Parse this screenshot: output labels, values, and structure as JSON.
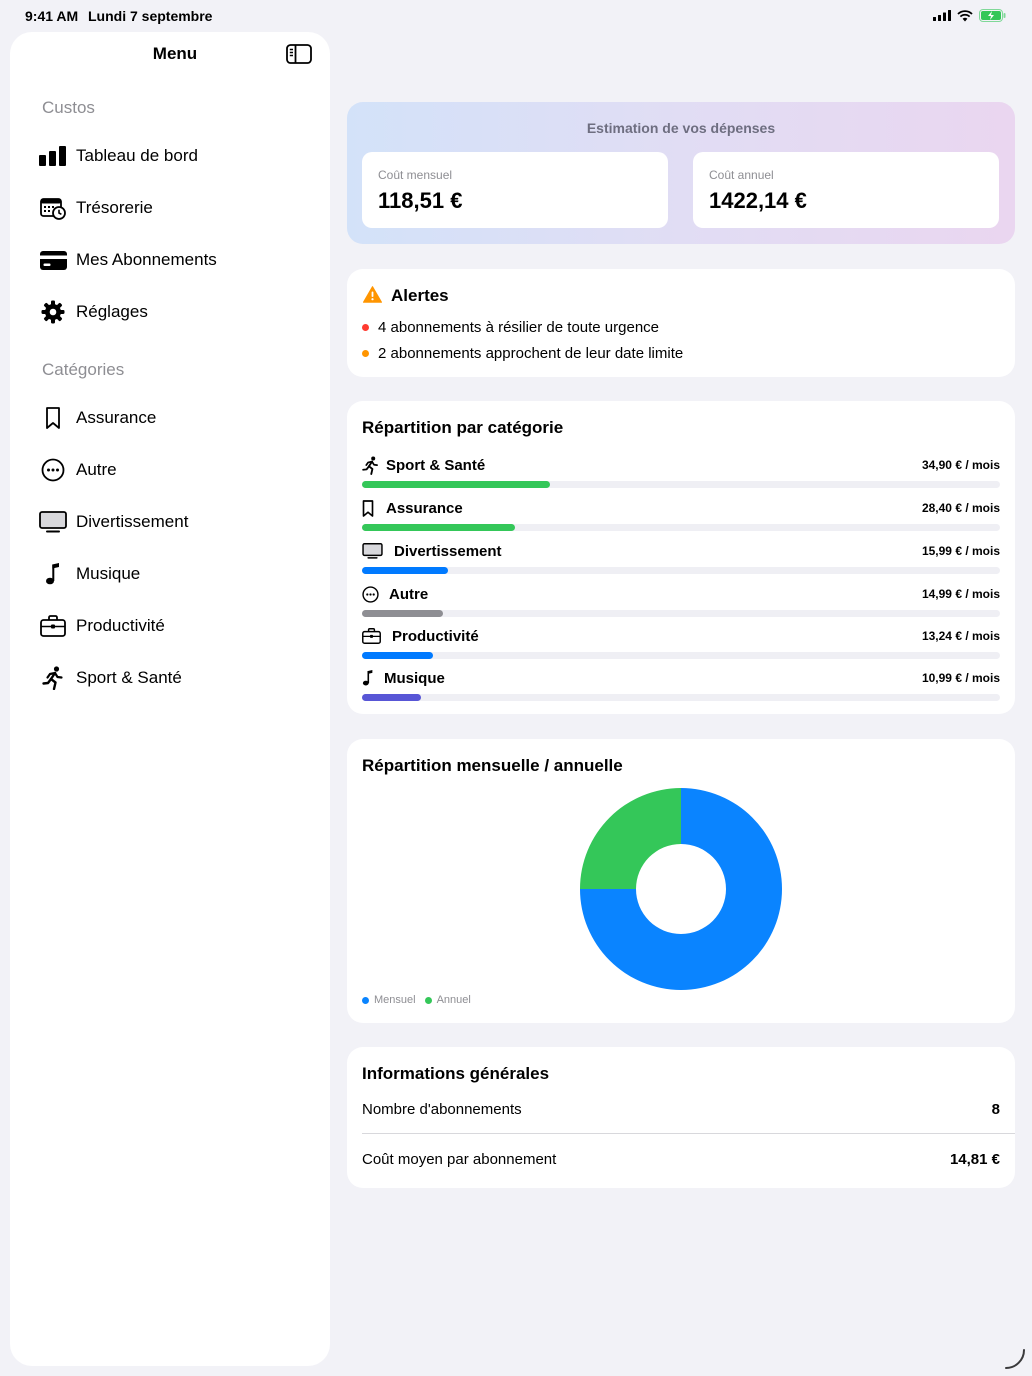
{
  "status_bar": {
    "time": "9:41 AM",
    "date": "Lundi 7 septembre"
  },
  "sidebar": {
    "title": "Menu",
    "sections": [
      {
        "header": "Custos",
        "items": [
          {
            "label": "Tableau de bord",
            "icon": "chart-bar-icon"
          },
          {
            "label": "Trésorerie",
            "icon": "calendar-clock-icon"
          },
          {
            "label": "Mes Abonnements",
            "icon": "credit-card-icon"
          },
          {
            "label": "Réglages",
            "icon": "gear-icon"
          }
        ]
      },
      {
        "header": "Catégories",
        "items": [
          {
            "label": "Assurance",
            "icon": "bookmark-icon"
          },
          {
            "label": "Autre",
            "icon": "ellipsis-circle-icon"
          },
          {
            "label": "Divertissement",
            "icon": "display-icon"
          },
          {
            "label": "Musique",
            "icon": "music-note-icon"
          },
          {
            "label": "Productivité",
            "icon": "briefcase-icon"
          },
          {
            "label": "Sport & Santé",
            "icon": "figure-run-icon"
          }
        ]
      }
    ]
  },
  "estimate": {
    "title": "Estimation de vos dépenses",
    "monthly_label": "Coût mensuel",
    "monthly_value": "118,51 €",
    "annual_label": "Coût annuel",
    "annual_value": "1422,14 €"
  },
  "alerts": {
    "title": "Alertes",
    "items": [
      {
        "text": "4 abonnements à résilier de toute urgence",
        "color": "#ff3b30"
      },
      {
        "text": "2 abonnements approchent de leur date limite",
        "color": "#ff9500"
      }
    ]
  },
  "categories": {
    "title": "Répartition par catégorie",
    "items": [
      {
        "name": "Sport & Santé",
        "amount": "34,90 € / mois",
        "value": 34.9,
        "color": "#34c759",
        "icon": "figure-run-icon"
      },
      {
        "name": "Assurance",
        "amount": "28,40 € / mois",
        "value": 28.4,
        "color": "#34c759",
        "icon": "bookmark-icon"
      },
      {
        "name": "Divertissement",
        "amount": "15,99 € / mois",
        "value": 15.99,
        "color": "#007aff",
        "icon": "display-icon"
      },
      {
        "name": "Autre",
        "amount": "14,99 € / mois",
        "value": 14.99,
        "color": "#8e8e93",
        "icon": "ellipsis-circle-icon"
      },
      {
        "name": "Productivité",
        "amount": "13,24 € / mois",
        "value": 13.24,
        "color": "#007aff",
        "icon": "briefcase-icon"
      },
      {
        "name": "Musique",
        "amount": "10,99 € / mois",
        "value": 10.99,
        "color": "#5856d6",
        "icon": "music-note-icon"
      }
    ]
  },
  "monthly_annual": {
    "title": "Répartition mensuelle / annuelle",
    "legend": [
      {
        "label": "Mensuel",
        "color": "#0a84ff"
      },
      {
        "label": "Annuel",
        "color": "#34c759"
      }
    ]
  },
  "chart_data": {
    "type": "pie",
    "title": "Répartition mensuelle / annuelle",
    "categories": [
      "Mensuel",
      "Annuel"
    ],
    "values": [
      75,
      25
    ],
    "colors": [
      "#0a84ff",
      "#34c759"
    ],
    "donut": true,
    "legend": "bottom-left"
  },
  "info": {
    "title": "Informations générales",
    "rows": [
      {
        "label": "Nombre d'abonnements",
        "value": "8"
      },
      {
        "label": "Coût moyen par abonnement",
        "value": "14,81 €"
      }
    ]
  }
}
